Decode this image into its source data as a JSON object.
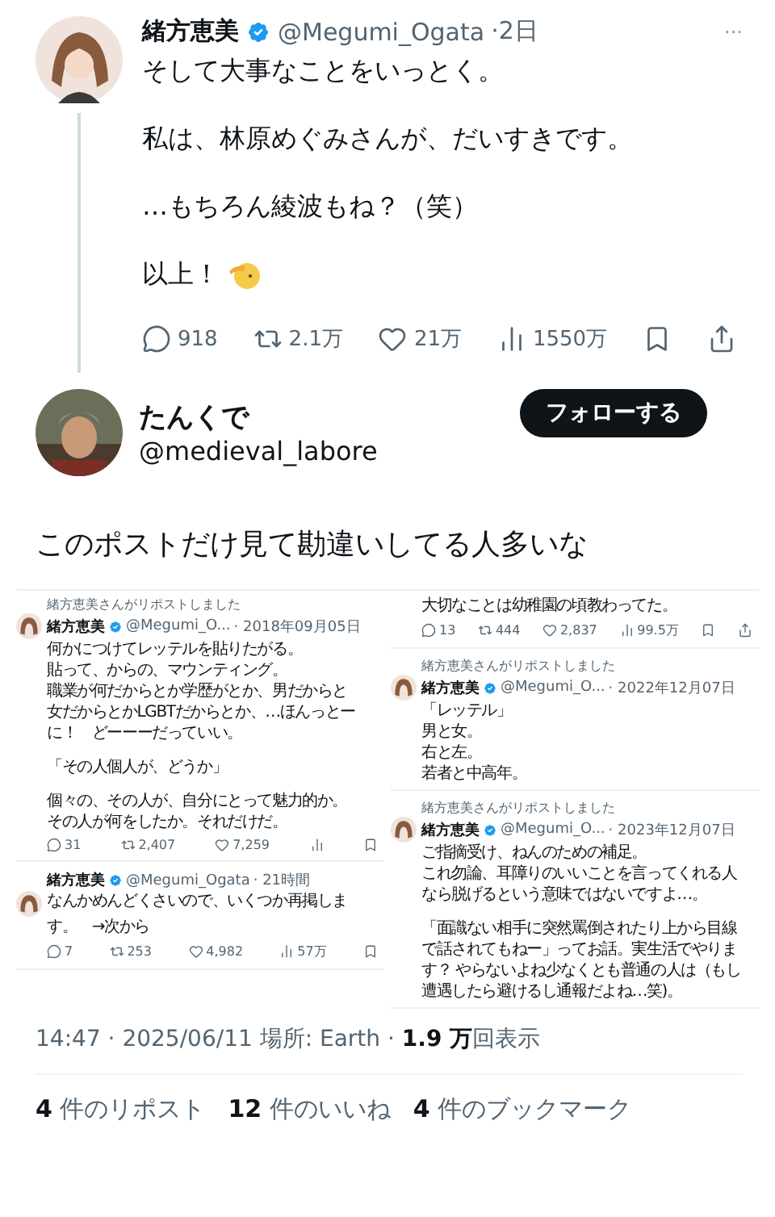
{
  "tweet": {
    "name": "緒方恵美",
    "verified": true,
    "handle": "@Megumi_Ogata",
    "time": "·2日",
    "more": "···",
    "paragraphs": [
      "そして大事なことをいっとく。",
      "私は、林原めぐみさんが、だいすきです。",
      "…もちろん綾波もね？（笑）",
      "以上！"
    ],
    "stats": [
      {
        "kind": "reply",
        "count": "918"
      },
      {
        "kind": "repost",
        "count": "2.1万"
      },
      {
        "kind": "like",
        "count": "21万"
      },
      {
        "kind": "views",
        "count": "1550万"
      },
      {
        "kind": "bookmark"
      },
      {
        "kind": "share"
      }
    ]
  },
  "reply": {
    "name": "たんくで",
    "handle": "@medieval_labore",
    "follow_button": "フォローする",
    "text": "このポストだけ見て勘違いしてる人多いな",
    "collage": {
      "columns": [
        [
          {
            "reposted_by": "緒方恵美さんがリポストしました",
            "name": "緒方恵美",
            "handle": "@Megumi_O...",
            "time": "· 2018年09月05日",
            "paragraphs": [
              [
                "何かにつけてレッテルを貼りたがる。",
                "貼って、からの、マウンティング。",
                "職業が何だからとか学歴がとか、男だからと",
                "女だからとかLGBTだからとか、…ほんっとー",
                "に！　どーーーだっていい。"
              ],
              [
                "「その人個人が、どうか」"
              ],
              [
                "個々の、その人が、自分にとって魅力的か。",
                "その人が何をしたか。それだけだ。"
              ]
            ],
            "stats": [
              {
                "kind": "reply",
                "count": "31"
              },
              {
                "kind": "repost",
                "count": "2,407"
              },
              {
                "kind": "like",
                "count": "7,259"
              },
              {
                "kind": "views"
              },
              {
                "kind": "bookmark"
              }
            ]
          },
          {
            "name": "緒方恵美",
            "handle": "@Megumi_Ogata",
            "time": "· 21時間",
            "paragraphs": [
              [
                "なんかめんどくさいので、いくつか再掲しま",
                "す。　→次から"
              ]
            ],
            "stats": [
              {
                "kind": "reply",
                "count": "7"
              },
              {
                "kind": "repost",
                "count": "253"
              },
              {
                "kind": "like",
                "count": "4,982"
              },
              {
                "kind": "views",
                "count": "57万"
              },
              {
                "kind": "bookmark"
              }
            ]
          }
        ],
        [
          {
            "paragraphs": [
              [
                "大切なことは幼稚園の頃教わってた。"
              ]
            ],
            "stats": [
              {
                "kind": "reply",
                "count": "13"
              },
              {
                "kind": "repost",
                "count": "444"
              },
              {
                "kind": "like",
                "count": "2,837"
              },
              {
                "kind": "views",
                "count": "99.5万"
              },
              {
                "kind": "bookmark"
              },
              {
                "kind": "share"
              }
            ]
          },
          {
            "reposted_by": "緒方恵美さんがリポストしました",
            "name": "緒方恵美",
            "handle": "@Megumi_O...",
            "time": "· 2022年12月07日",
            "paragraphs": [
              [
                "「レッテル」",
                "男と女。",
                "右と左。",
                "若者と中高年。"
              ]
            ]
          },
          {
            "reposted_by": "緒方恵美さんがリポストしました",
            "name": "緒方恵美",
            "handle": "@Megumi_O...",
            "time": "· 2023年12月07日",
            "paragraphs": [
              [
                "ご指摘受け、ねんのための補足。",
                "これ勿論、耳障りのいいことを言ってくれる人",
                "なら脱げるという意味ではないですよ…。"
              ],
              [
                "「面識ない相手に突然罵倒されたり上から目線",
                "で話されてもねー」ってお話。実生活でやりま",
                "す？ やらないよね少なくとも普通の人は（もし",
                "遭遇したら避けるし通報だよね…笑)。"
              ]
            ]
          }
        ]
      ]
    }
  },
  "meta": {
    "line": "14:47 · 2025/06/11 場所: Earth · **1.9 万**回表示",
    "counts": [
      "**4** 件のリポスト",
      "**12** 件のいいね",
      "**4** 件のブックマーク"
    ]
  }
}
